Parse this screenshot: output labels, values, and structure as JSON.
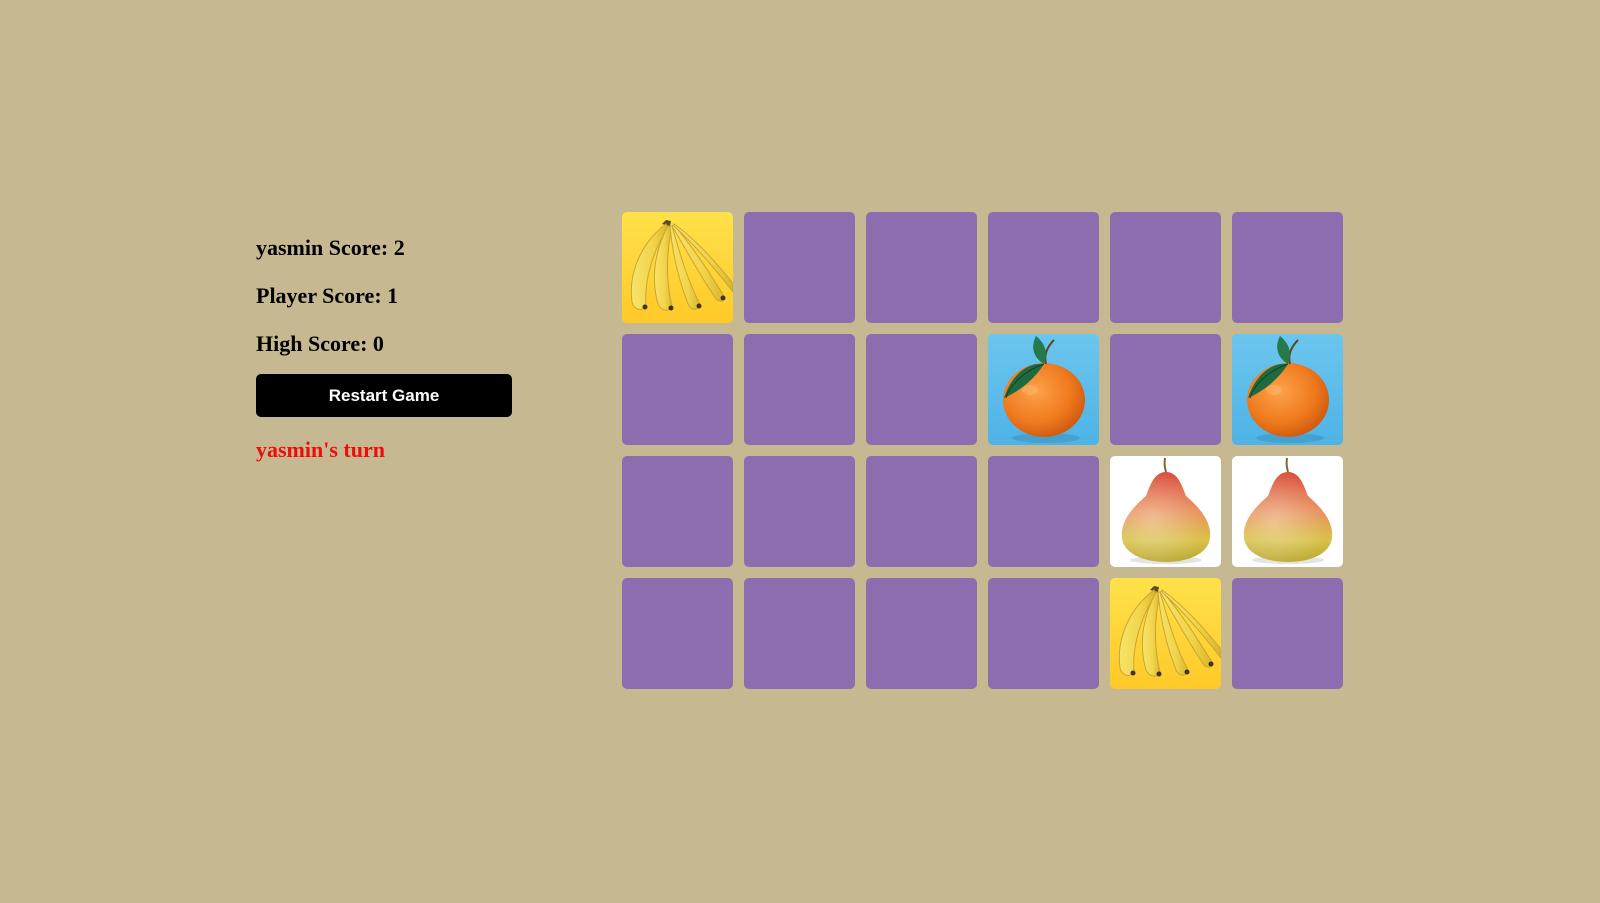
{
  "scores": {
    "player1": "yasmin Score: 2",
    "player2": "Player Score: 1",
    "high": "High Score: 0"
  },
  "restart_label": "Restart Game",
  "turn_text": "yasmin's turn",
  "colors": {
    "background": "#c6b991",
    "card_back": "#8d6db0",
    "turn_text": "#ee0d0d",
    "button": "#000000"
  },
  "board": {
    "columns": 6,
    "rows": 4,
    "cards": [
      {
        "state": "revealed",
        "fruit": "banana"
      },
      {
        "state": "hidden"
      },
      {
        "state": "hidden"
      },
      {
        "state": "hidden"
      },
      {
        "state": "hidden"
      },
      {
        "state": "hidden"
      },
      {
        "state": "hidden"
      },
      {
        "state": "hidden"
      },
      {
        "state": "hidden"
      },
      {
        "state": "revealed",
        "fruit": "orange"
      },
      {
        "state": "hidden"
      },
      {
        "state": "revealed",
        "fruit": "orange"
      },
      {
        "state": "hidden"
      },
      {
        "state": "hidden"
      },
      {
        "state": "hidden"
      },
      {
        "state": "hidden"
      },
      {
        "state": "revealed",
        "fruit": "pear"
      },
      {
        "state": "revealed",
        "fruit": "pear"
      },
      {
        "state": "hidden"
      },
      {
        "state": "hidden"
      },
      {
        "state": "hidden"
      },
      {
        "state": "hidden"
      },
      {
        "state": "revealed",
        "fruit": "banana"
      },
      {
        "state": "hidden"
      }
    ]
  }
}
